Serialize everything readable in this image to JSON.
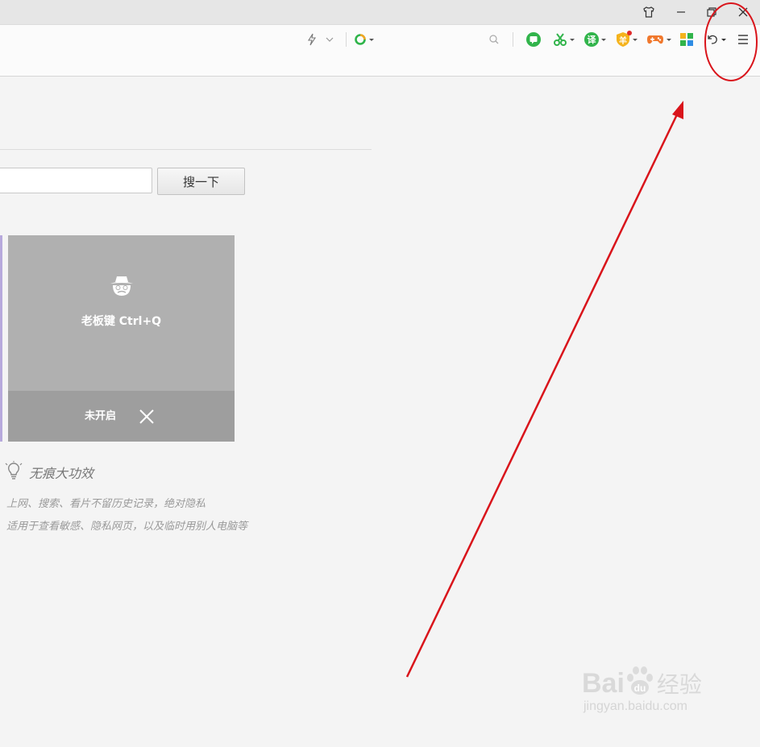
{
  "window": {
    "controls": [
      "skin",
      "minimize",
      "restore",
      "close"
    ]
  },
  "toolbar": {
    "icons": [
      "lightning-icon",
      "chevron-down-icon",
      "search-engine-icon",
      "search-icon",
      "chat-icon",
      "scissors-icon",
      "translate-icon",
      "shield-icon",
      "game-icon",
      "apps-icon",
      "undo-icon",
      "menu-icon"
    ],
    "translate_label": "译",
    "shield_label": "羊"
  },
  "search": {
    "input_value": "",
    "button_label": "搜一下"
  },
  "boss_key_card": {
    "title": "老板键 Ctrl+Q",
    "status": "未开启"
  },
  "tips": {
    "title": "无痕大功效",
    "line1": "上网、搜索、看片不留历史记录，绝对隐私",
    "line2": "适用于查看敏感、隐私网页，以及临时用别人电脑等"
  },
  "watermark": {
    "brand_left": "Bai",
    "brand_right": "经验",
    "url": "jingyan.baidu.com"
  },
  "colors": {
    "annotation_red": "#d9141b",
    "accent_green": "#3cb83c",
    "card_gray": "#b0b0b0"
  }
}
